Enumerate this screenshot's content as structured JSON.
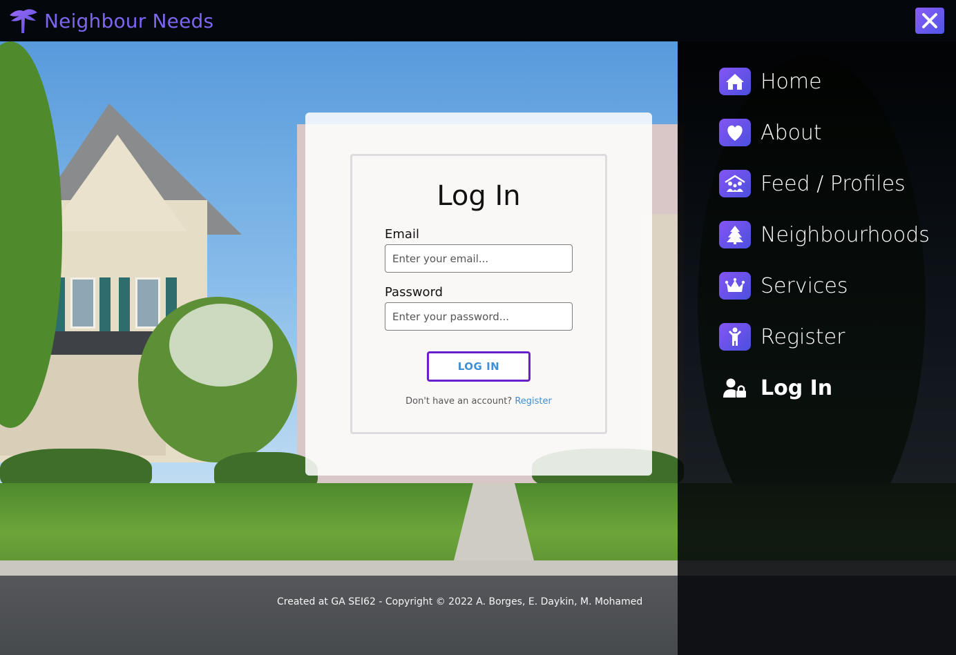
{
  "header": {
    "brand_name": "Neighbour Needs",
    "brand_color": "#7b66f0",
    "logo_icon": "tree-icon",
    "close_icon": "close-icon"
  },
  "menu": {
    "items": [
      {
        "label": "Home",
        "icon": "home-icon"
      },
      {
        "label": "About",
        "icon": "heart-icon"
      },
      {
        "label": "Feed / Profiles",
        "icon": "people-icon"
      },
      {
        "label": "Neighbourhoods",
        "icon": "tree-icon"
      },
      {
        "label": "Services",
        "icon": "crown-icon"
      },
      {
        "label": "Register",
        "icon": "child-icon"
      },
      {
        "label": "Log In",
        "icon": "user-lock-icon",
        "active": true
      }
    ],
    "accent": "#6a4ff0"
  },
  "login": {
    "title": "Log In",
    "email_label": "Email",
    "email_placeholder": "Enter your email...",
    "email_value": "",
    "password_label": "Password",
    "password_placeholder": "Enter your password...",
    "password_value": "",
    "submit_label": "LOG IN",
    "signup_prompt": "Don't have an account?",
    "signup_link": "Register",
    "button_border_color": "#6a1fcf",
    "link_color": "#3d8fd6"
  },
  "footer": {
    "text": "Created at GA SEI62 - Copyright © 2022 A. Borges, E. Daykin, M. Mohamed"
  }
}
